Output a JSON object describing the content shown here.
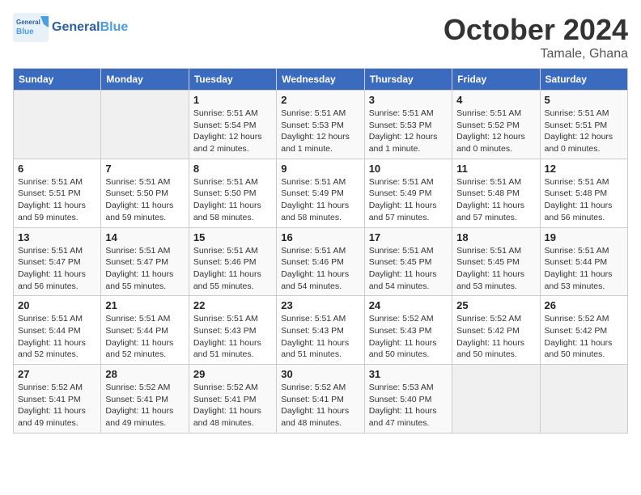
{
  "header": {
    "logo": {
      "text_general": "General",
      "text_blue": "Blue"
    },
    "month_title": "October 2024",
    "subtitle": "Tamale, Ghana"
  },
  "weekdays": [
    "Sunday",
    "Monday",
    "Tuesday",
    "Wednesday",
    "Thursday",
    "Friday",
    "Saturday"
  ],
  "weeks": [
    [
      {
        "day": "",
        "info": ""
      },
      {
        "day": "",
        "info": ""
      },
      {
        "day": "1",
        "info": "Sunrise: 5:51 AM\nSunset: 5:54 PM\nDaylight: 12 hours\nand 2 minutes."
      },
      {
        "day": "2",
        "info": "Sunrise: 5:51 AM\nSunset: 5:53 PM\nDaylight: 12 hours\nand 1 minute."
      },
      {
        "day": "3",
        "info": "Sunrise: 5:51 AM\nSunset: 5:53 PM\nDaylight: 12 hours\nand 1 minute."
      },
      {
        "day": "4",
        "info": "Sunrise: 5:51 AM\nSunset: 5:52 PM\nDaylight: 12 hours\nand 0 minutes."
      },
      {
        "day": "5",
        "info": "Sunrise: 5:51 AM\nSunset: 5:51 PM\nDaylight: 12 hours\nand 0 minutes."
      }
    ],
    [
      {
        "day": "6",
        "info": "Sunrise: 5:51 AM\nSunset: 5:51 PM\nDaylight: 11 hours\nand 59 minutes."
      },
      {
        "day": "7",
        "info": "Sunrise: 5:51 AM\nSunset: 5:50 PM\nDaylight: 11 hours\nand 59 minutes."
      },
      {
        "day": "8",
        "info": "Sunrise: 5:51 AM\nSunset: 5:50 PM\nDaylight: 11 hours\nand 58 minutes."
      },
      {
        "day": "9",
        "info": "Sunrise: 5:51 AM\nSunset: 5:49 PM\nDaylight: 11 hours\nand 58 minutes."
      },
      {
        "day": "10",
        "info": "Sunrise: 5:51 AM\nSunset: 5:49 PM\nDaylight: 11 hours\nand 57 minutes."
      },
      {
        "day": "11",
        "info": "Sunrise: 5:51 AM\nSunset: 5:48 PM\nDaylight: 11 hours\nand 57 minutes."
      },
      {
        "day": "12",
        "info": "Sunrise: 5:51 AM\nSunset: 5:48 PM\nDaylight: 11 hours\nand 56 minutes."
      }
    ],
    [
      {
        "day": "13",
        "info": "Sunrise: 5:51 AM\nSunset: 5:47 PM\nDaylight: 11 hours\nand 56 minutes."
      },
      {
        "day": "14",
        "info": "Sunrise: 5:51 AM\nSunset: 5:47 PM\nDaylight: 11 hours\nand 55 minutes."
      },
      {
        "day": "15",
        "info": "Sunrise: 5:51 AM\nSunset: 5:46 PM\nDaylight: 11 hours\nand 55 minutes."
      },
      {
        "day": "16",
        "info": "Sunrise: 5:51 AM\nSunset: 5:46 PM\nDaylight: 11 hours\nand 54 minutes."
      },
      {
        "day": "17",
        "info": "Sunrise: 5:51 AM\nSunset: 5:45 PM\nDaylight: 11 hours\nand 54 minutes."
      },
      {
        "day": "18",
        "info": "Sunrise: 5:51 AM\nSunset: 5:45 PM\nDaylight: 11 hours\nand 53 minutes."
      },
      {
        "day": "19",
        "info": "Sunrise: 5:51 AM\nSunset: 5:44 PM\nDaylight: 11 hours\nand 53 minutes."
      }
    ],
    [
      {
        "day": "20",
        "info": "Sunrise: 5:51 AM\nSunset: 5:44 PM\nDaylight: 11 hours\nand 52 minutes."
      },
      {
        "day": "21",
        "info": "Sunrise: 5:51 AM\nSunset: 5:44 PM\nDaylight: 11 hours\nand 52 minutes."
      },
      {
        "day": "22",
        "info": "Sunrise: 5:51 AM\nSunset: 5:43 PM\nDaylight: 11 hours\nand 51 minutes."
      },
      {
        "day": "23",
        "info": "Sunrise: 5:51 AM\nSunset: 5:43 PM\nDaylight: 11 hours\nand 51 minutes."
      },
      {
        "day": "24",
        "info": "Sunrise: 5:52 AM\nSunset: 5:43 PM\nDaylight: 11 hours\nand 50 minutes."
      },
      {
        "day": "25",
        "info": "Sunrise: 5:52 AM\nSunset: 5:42 PM\nDaylight: 11 hours\nand 50 minutes."
      },
      {
        "day": "26",
        "info": "Sunrise: 5:52 AM\nSunset: 5:42 PM\nDaylight: 11 hours\nand 50 minutes."
      }
    ],
    [
      {
        "day": "27",
        "info": "Sunrise: 5:52 AM\nSunset: 5:41 PM\nDaylight: 11 hours\nand 49 minutes."
      },
      {
        "day": "28",
        "info": "Sunrise: 5:52 AM\nSunset: 5:41 PM\nDaylight: 11 hours\nand 49 minutes."
      },
      {
        "day": "29",
        "info": "Sunrise: 5:52 AM\nSunset: 5:41 PM\nDaylight: 11 hours\nand 48 minutes."
      },
      {
        "day": "30",
        "info": "Sunrise: 5:52 AM\nSunset: 5:41 PM\nDaylight: 11 hours\nand 48 minutes."
      },
      {
        "day": "31",
        "info": "Sunrise: 5:53 AM\nSunset: 5:40 PM\nDaylight: 11 hours\nand 47 minutes."
      },
      {
        "day": "",
        "info": ""
      },
      {
        "day": "",
        "info": ""
      }
    ]
  ]
}
